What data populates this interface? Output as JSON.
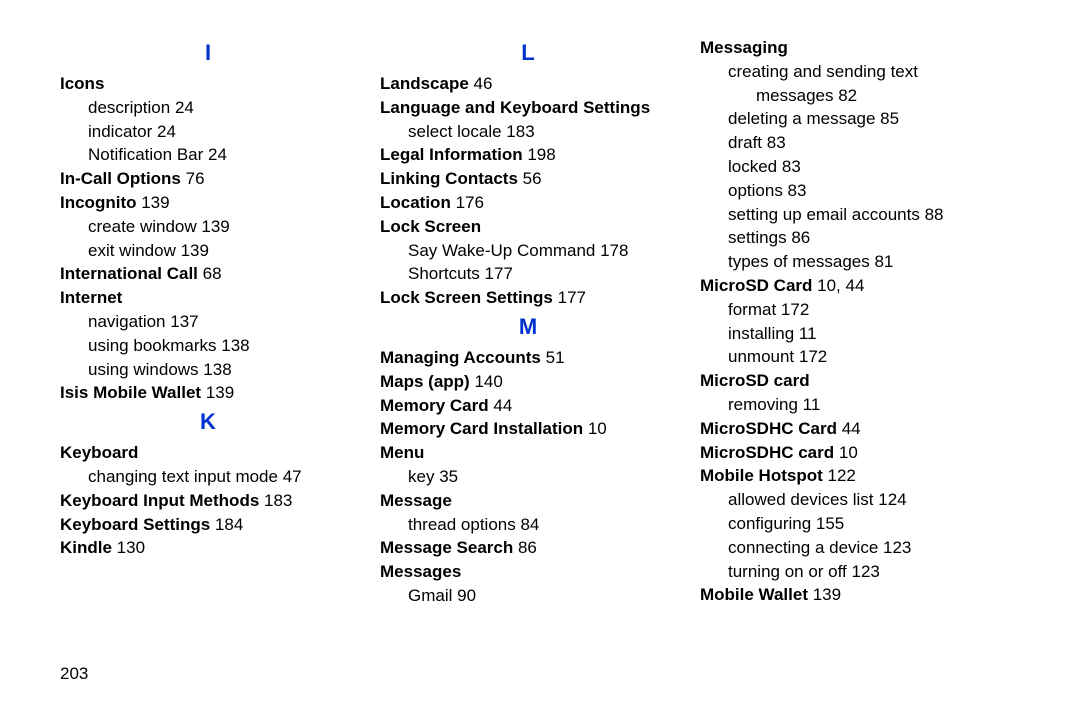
{
  "page_number": "203",
  "columns": [
    {
      "segments": [
        {
          "type": "letter",
          "text": "I"
        },
        {
          "type": "entry",
          "bold": "Icons"
        },
        {
          "type": "sub",
          "text": "description",
          "page": "24"
        },
        {
          "type": "sub",
          "text": "indicator",
          "page": "24"
        },
        {
          "type": "sub",
          "text": "Notification Bar",
          "page": "24"
        },
        {
          "type": "entry",
          "bold": "In-Call Options",
          "page": "76"
        },
        {
          "type": "entry",
          "bold": "Incognito",
          "page": "139"
        },
        {
          "type": "sub",
          "text": "create window",
          "page": "139"
        },
        {
          "type": "sub",
          "text": "exit window",
          "page": "139"
        },
        {
          "type": "entry",
          "bold": "International Call",
          "page": "68"
        },
        {
          "type": "entry",
          "bold": "Internet"
        },
        {
          "type": "sub",
          "text": "navigation",
          "page": "137"
        },
        {
          "type": "sub",
          "text": "using bookmarks",
          "page": "138"
        },
        {
          "type": "sub",
          "text": "using windows",
          "page": "138"
        },
        {
          "type": "entry",
          "bold": "Isis Mobile Wallet",
          "page": "139"
        },
        {
          "type": "letter",
          "text": "K"
        },
        {
          "type": "entry",
          "bold": "Keyboard"
        },
        {
          "type": "sub",
          "text": "changing text input mode",
          "page": "47"
        },
        {
          "type": "entry",
          "bold": "Keyboard Input Methods",
          "page": "183"
        },
        {
          "type": "entry",
          "bold": "Keyboard Settings",
          "page": "184"
        },
        {
          "type": "entry",
          "bold": "Kindle",
          "page": "130"
        }
      ]
    },
    {
      "segments": [
        {
          "type": "letter",
          "text": "L"
        },
        {
          "type": "entry",
          "bold": "Landscape",
          "page": "46"
        },
        {
          "type": "entry",
          "bold": "Language and Keyboard Settings"
        },
        {
          "type": "sub",
          "text": "select locale",
          "page": "183"
        },
        {
          "type": "entry",
          "bold": "Legal Information",
          "page": "198"
        },
        {
          "type": "entry",
          "bold": "Linking Contacts",
          "page": "56"
        },
        {
          "type": "entry",
          "bold": "Location",
          "page": "176"
        },
        {
          "type": "entry",
          "bold": "Lock Screen"
        },
        {
          "type": "sub",
          "text": "Say Wake-Up Command",
          "page": "178"
        },
        {
          "type": "sub",
          "text": "Shortcuts",
          "page": "177"
        },
        {
          "type": "entry",
          "bold": "Lock Screen Settings",
          "page": "177"
        },
        {
          "type": "letter",
          "text": "M"
        },
        {
          "type": "entry",
          "bold": "Managing Accounts",
          "page": "51"
        },
        {
          "type": "entry",
          "bold": "Maps (app)",
          "page": "140"
        },
        {
          "type": "entry",
          "bold": "Memory Card",
          "page": "44"
        },
        {
          "type": "entry",
          "bold": "Memory Card Installation",
          "page": "10"
        },
        {
          "type": "entry",
          "bold": "Menu"
        },
        {
          "type": "sub",
          "text": "key",
          "page": "35"
        },
        {
          "type": "entry",
          "bold": "Message"
        },
        {
          "type": "sub",
          "text": "thread options",
          "page": "84"
        },
        {
          "type": "entry",
          "bold": "Message Search",
          "page": "86"
        },
        {
          "type": "entry",
          "bold": "Messages"
        },
        {
          "type": "sub",
          "text": "Gmail",
          "page": "90"
        }
      ]
    },
    {
      "segments": [
        {
          "type": "entry",
          "bold": "Messaging"
        },
        {
          "type": "subwrap",
          "text": "creating and sending text messages",
          "page": "82"
        },
        {
          "type": "sub",
          "text": "deleting a message",
          "page": "85"
        },
        {
          "type": "sub",
          "text": "draft",
          "page": "83"
        },
        {
          "type": "sub",
          "text": "locked",
          "page": "83"
        },
        {
          "type": "sub",
          "text": "options",
          "page": "83"
        },
        {
          "type": "sub",
          "text": "setting up email accounts",
          "page": "88"
        },
        {
          "type": "sub",
          "text": "settings",
          "page": "86"
        },
        {
          "type": "sub",
          "text": "types of messages",
          "page": "81"
        },
        {
          "type": "entry",
          "bold": "MicroSD Card",
          "page": "10, 44"
        },
        {
          "type": "sub",
          "text": "format",
          "page": "172"
        },
        {
          "type": "sub",
          "text": "installing",
          "page": "11"
        },
        {
          "type": "sub",
          "text": "unmount",
          "page": "172"
        },
        {
          "type": "entry",
          "bold": "MicroSD card"
        },
        {
          "type": "sub",
          "text": "removing",
          "page": "11"
        },
        {
          "type": "entry",
          "bold": "MicroSDHC Card",
          "page": "44"
        },
        {
          "type": "entry",
          "bold": "MicroSDHC card",
          "page": "10"
        },
        {
          "type": "entry",
          "bold": "Mobile Hotspot",
          "page": "122"
        },
        {
          "type": "sub",
          "text": "allowed devices list",
          "page": "124"
        },
        {
          "type": "sub",
          "text": "configuring",
          "page": "155"
        },
        {
          "type": "sub",
          "text": "connecting a device",
          "page": "123"
        },
        {
          "type": "sub",
          "text": "turning on or off",
          "page": "123"
        },
        {
          "type": "entry",
          "bold": "Mobile Wallet",
          "page": "139"
        }
      ]
    }
  ]
}
